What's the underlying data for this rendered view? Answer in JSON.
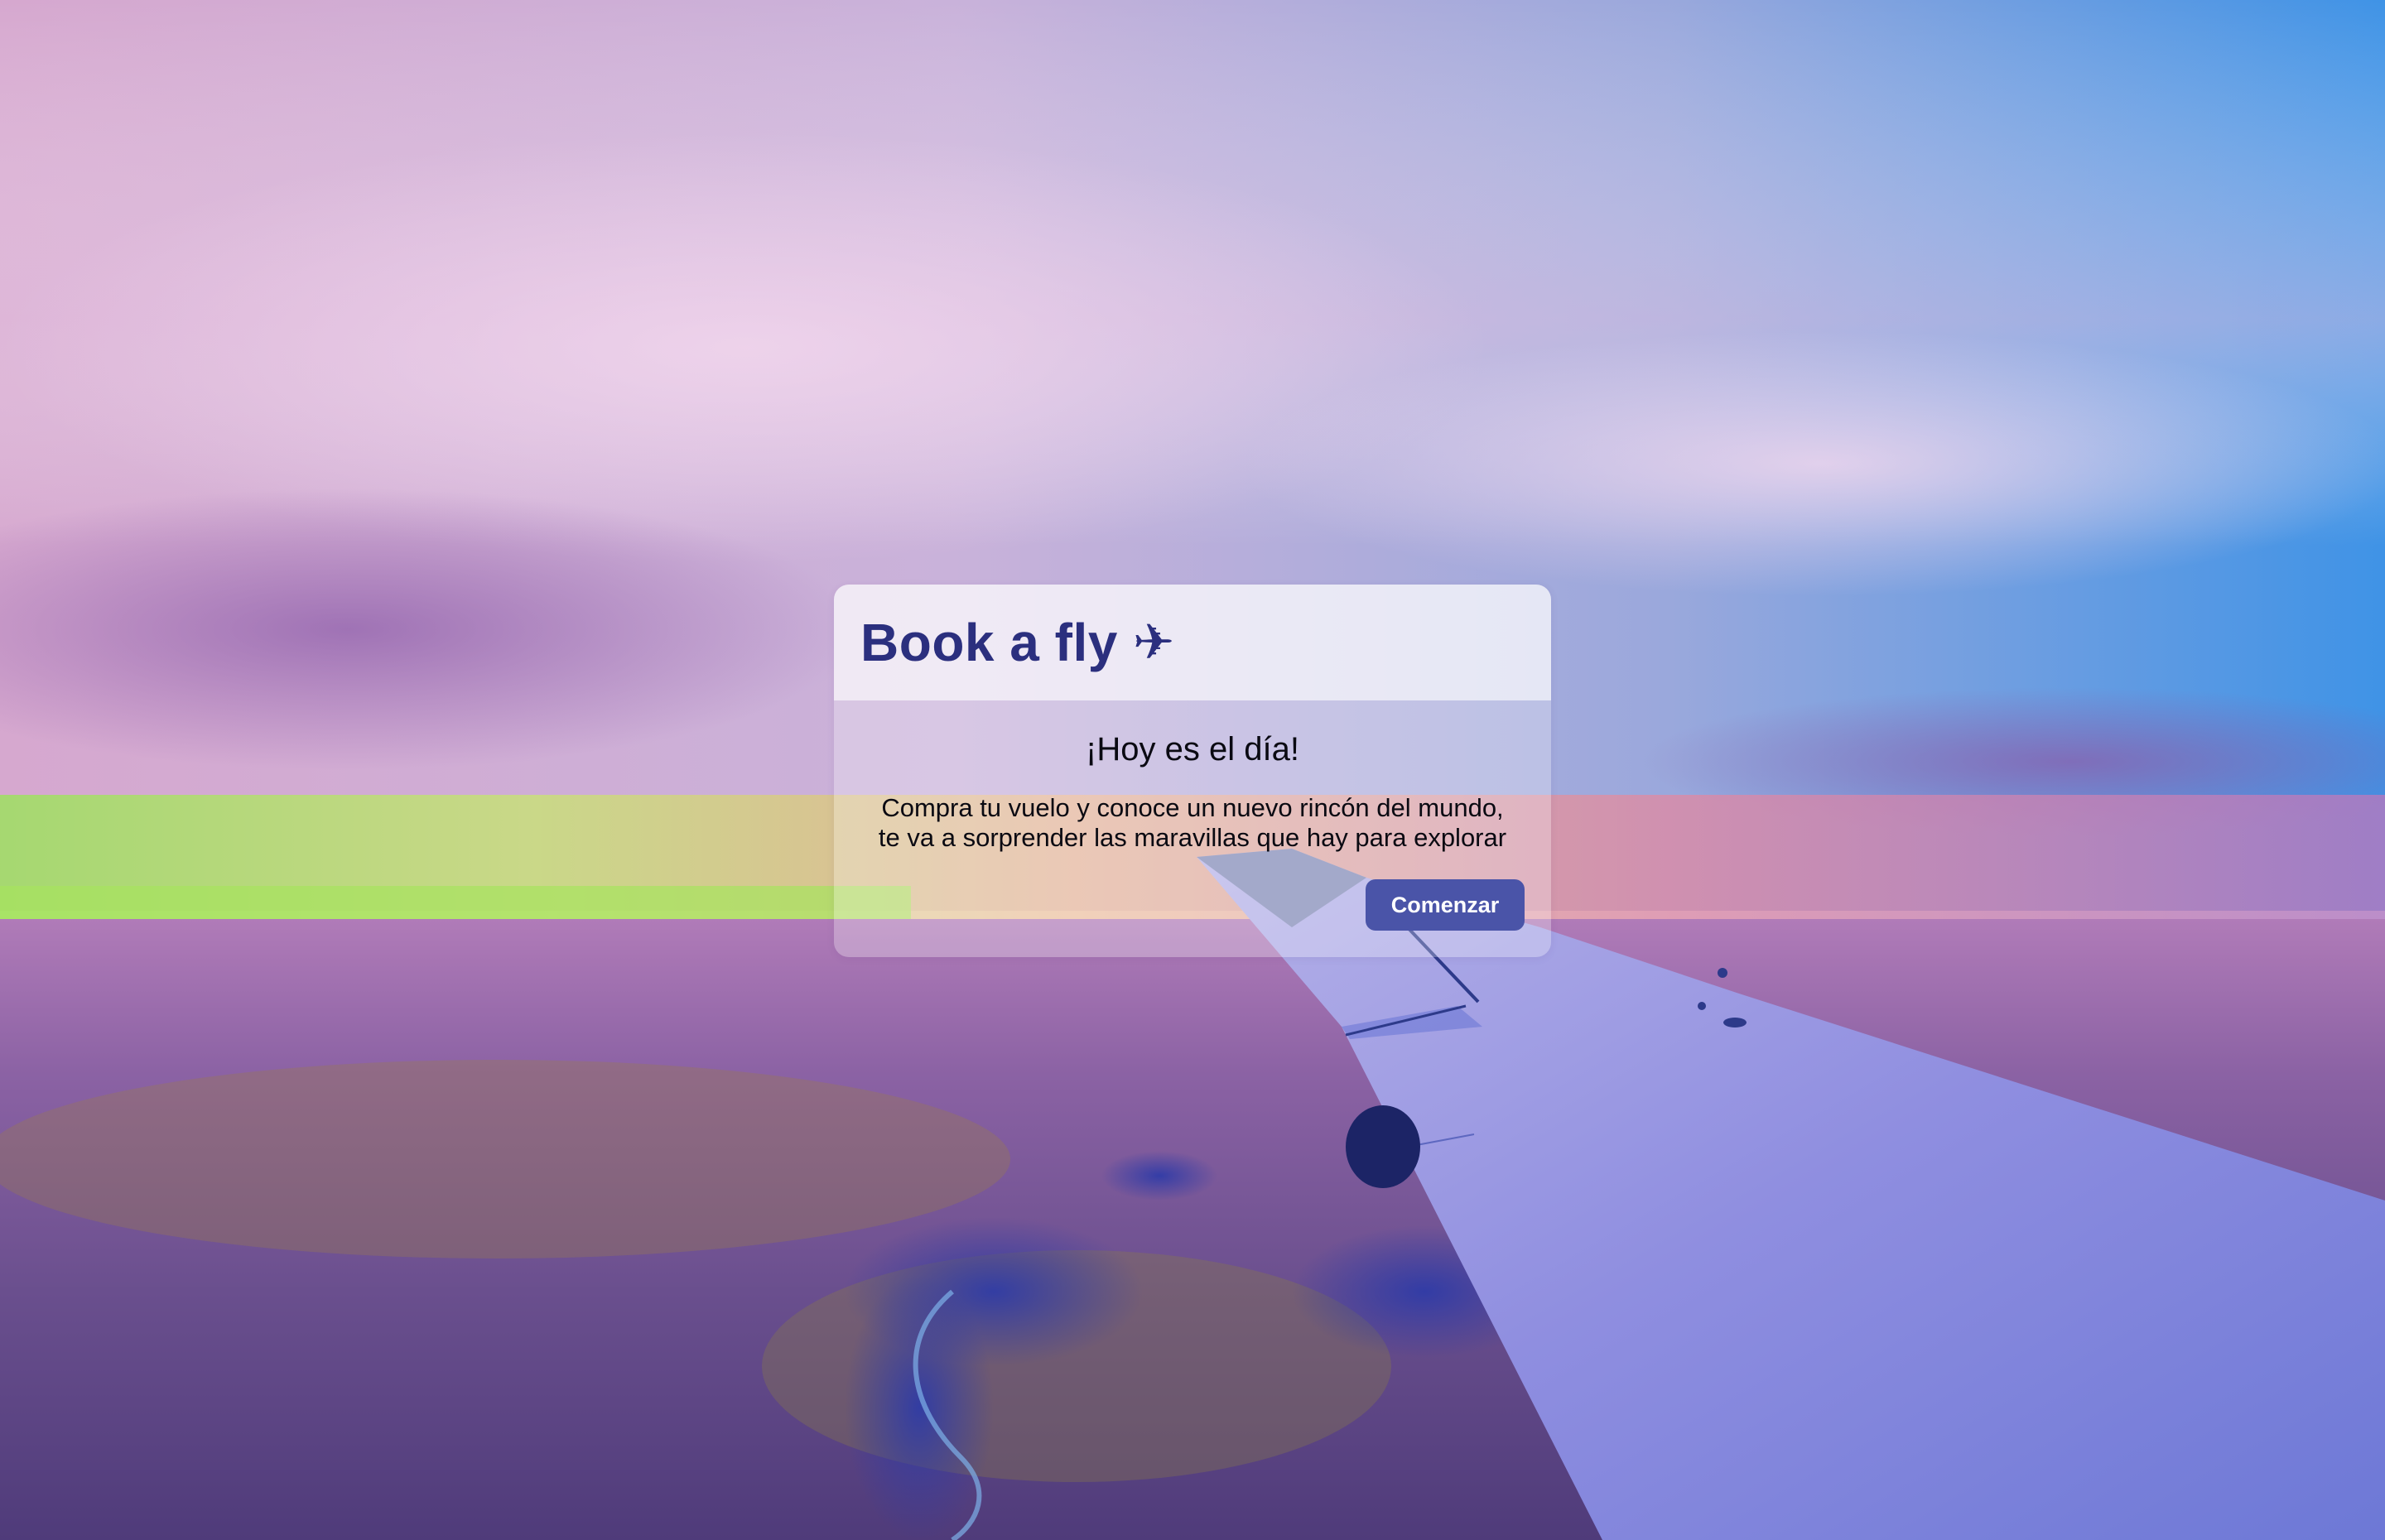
{
  "app": {
    "title": "Book a fly",
    "logo_icon": "airplane-icon",
    "logo_glyph": "✈"
  },
  "card": {
    "headline": "¡Hoy es el día!",
    "message_line_1": "Compra tu vuelo y conoce un nuevo rincón del mundo,",
    "message_line_2": "te va a sorprender las maravillas que hay para explorar",
    "cta_label": "Comenzar"
  },
  "background": {
    "description_icon": "sky-airplane-wing-background"
  },
  "colors": {
    "brand": "#2b2f7e",
    "button": "#4a54a8",
    "button_text": "#ffffff",
    "body_text": "#0a0a12"
  }
}
